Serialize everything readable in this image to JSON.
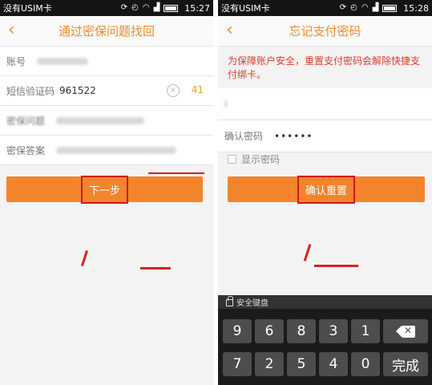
{
  "left": {
    "status": {
      "carrier": "没有USIM卡",
      "time": "15:27"
    },
    "title": "通过密保问题找回",
    "back_glyph": "‹",
    "fields": [
      {
        "label": "账号"
      },
      {
        "label": "短信验证码",
        "value": "961522",
        "countdown": "41"
      },
      {
        "label": "密保问题"
      },
      {
        "label": "密保答案"
      }
    ],
    "clear_glyph": "×",
    "next_button": "下一步"
  },
  "right": {
    "status": {
      "carrier": "没有USIM卡",
      "time": "15:28"
    },
    "title": "忘记支付密码",
    "back_glyph": "‹",
    "warning": "为保障账户安全，重置支付密码会解除快捷支付绑卡。",
    "confirm_label": "确认密码",
    "confirm_value": "••••••",
    "show_password": "显示密码",
    "reset_button": "确认重置",
    "keyboard": {
      "title": "安全键盘",
      "row1": [
        "9",
        "6",
        "8",
        "3",
        "1"
      ],
      "row2": [
        "7",
        "2",
        "5",
        "4",
        "0"
      ],
      "done": "完成",
      "backspace_mark": "✕"
    }
  },
  "colors": {
    "accent": "#f2842c",
    "warning": "#e03a2a",
    "highlight": "#d01818"
  }
}
